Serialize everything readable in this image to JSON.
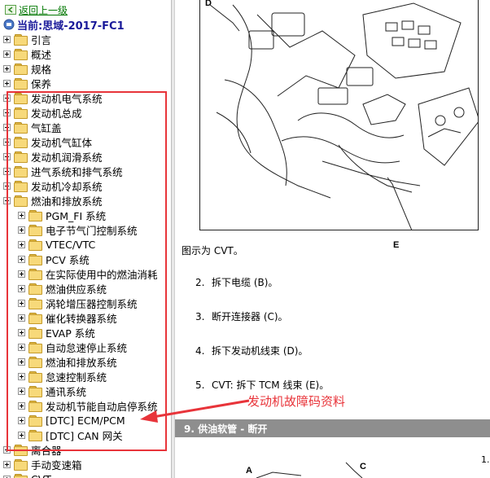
{
  "nav": {
    "back_label": "返回上一级",
    "current_label": "当前:思域-2017-FC1"
  },
  "tree": [
    {
      "label": "引言",
      "level": 0,
      "state": "collapsed"
    },
    {
      "label": "概述",
      "level": 0,
      "state": "collapsed"
    },
    {
      "label": "规格",
      "level": 0,
      "state": "collapsed"
    },
    {
      "label": "保养",
      "level": 0,
      "state": "collapsed"
    },
    {
      "label": "发动机电气系统",
      "level": 0,
      "state": "collapsed"
    },
    {
      "label": "发动机总成",
      "level": 0,
      "state": "collapsed"
    },
    {
      "label": "气缸盖",
      "level": 0,
      "state": "collapsed"
    },
    {
      "label": "发动机气缸体",
      "level": 0,
      "state": "collapsed"
    },
    {
      "label": "发动机润滑系统",
      "level": 0,
      "state": "collapsed"
    },
    {
      "label": "进气系统和排气系统",
      "level": 0,
      "state": "collapsed"
    },
    {
      "label": "发动机冷却系统",
      "level": 0,
      "state": "collapsed"
    },
    {
      "label": "燃油和排放系统",
      "level": 0,
      "state": "expanded"
    },
    {
      "label": "PGM_FI 系统",
      "level": 1,
      "state": "collapsed"
    },
    {
      "label": "电子节气门控制系统",
      "level": 1,
      "state": "collapsed"
    },
    {
      "label": "VTEC/VTC",
      "level": 1,
      "state": "collapsed"
    },
    {
      "label": "PCV 系统",
      "level": 1,
      "state": "collapsed"
    },
    {
      "label": "在实际使用中的燃油消耗",
      "level": 1,
      "state": "collapsed"
    },
    {
      "label": "燃油供应系统",
      "level": 1,
      "state": "collapsed"
    },
    {
      "label": "涡轮增压器控制系统",
      "level": 1,
      "state": "collapsed"
    },
    {
      "label": "催化转换器系统",
      "level": 1,
      "state": "collapsed"
    },
    {
      "label": "EVAP 系统",
      "level": 1,
      "state": "collapsed"
    },
    {
      "label": "自动怠速停止系统",
      "level": 1,
      "state": "collapsed"
    },
    {
      "label": "燃油和排放系统",
      "level": 1,
      "state": "collapsed"
    },
    {
      "label": "怠速控制系统",
      "level": 1,
      "state": "collapsed"
    },
    {
      "label": "通讯系统",
      "level": 1,
      "state": "collapsed"
    },
    {
      "label": "发动机节能自动启停系统",
      "level": 1,
      "state": "collapsed"
    },
    {
      "label": "[DTC] ECM/PCM",
      "level": 1,
      "state": "collapsed"
    },
    {
      "label": "[DTC] CAN 网关",
      "level": 1,
      "state": "collapsed"
    },
    {
      "label": "离合器",
      "level": 0,
      "state": "collapsed"
    },
    {
      "label": "手动变速箱",
      "level": 0,
      "state": "collapsed"
    },
    {
      "label": "CVT",
      "level": 0,
      "state": "collapsed"
    }
  ],
  "annotation": {
    "text": "发动机故障码资料",
    "color": "#e8343a"
  },
  "document": {
    "figure_callouts": [
      "D",
      "A",
      "E"
    ],
    "caption": "图示为 CVT。",
    "steps": [
      {
        "num": "2.",
        "text": "拆下电缆 (B)。"
      },
      {
        "num": "3.",
        "text": "断开连接器 (C)。"
      },
      {
        "num": "4.",
        "text": "拆下发动机线束 (D)。"
      },
      {
        "num": "5.",
        "text": "CVT: 拆下 TCM 线束 (E)。"
      }
    ],
    "section_title": "9. 供油软管 - 断开",
    "lower_figure_callouts": [
      "A",
      "C"
    ],
    "lower_step_num": "1."
  },
  "colors": {
    "highlight_red": "#e8343a",
    "current_label_blue": "#1a1a9a",
    "back_link_green": "#007700",
    "section_bar_gray": "#8e8e8e"
  }
}
